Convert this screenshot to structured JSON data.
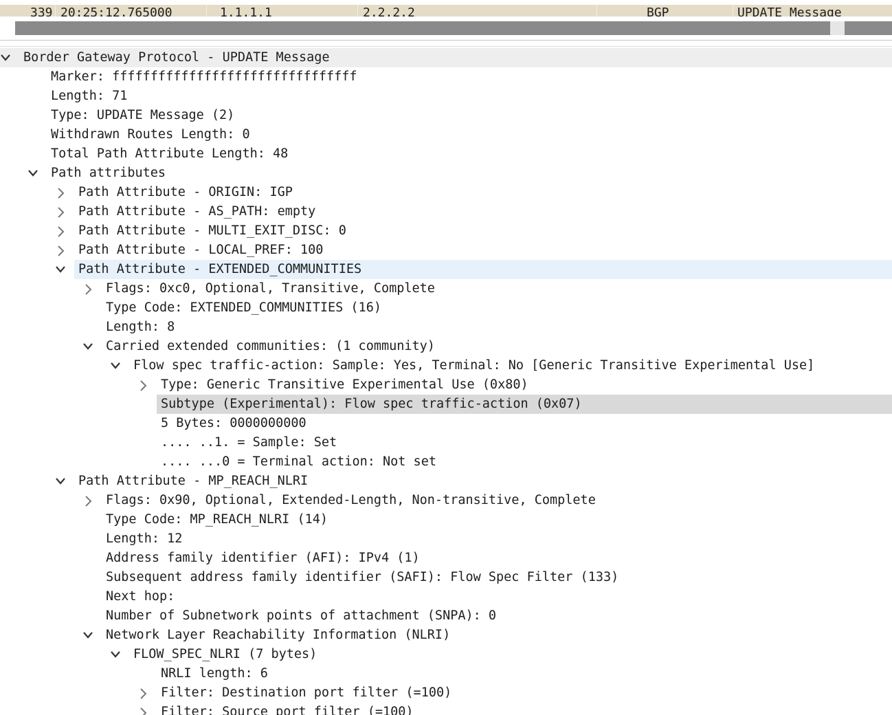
{
  "packet_list": {
    "row": {
      "no": "339",
      "time": "20:25:12.765000",
      "source": "1.1.1.1",
      "destination": "2.2.2.2",
      "protocol": "BGP",
      "info": "UPDATE Message"
    }
  },
  "tree": {
    "root": "Border Gateway Protocol - UPDATE Message",
    "marker": "Marker: ffffffffffffffffffffffffffffffff",
    "length": "Length: 71",
    "type": "Type: UPDATE Message (2)",
    "withdrawn": "Withdrawn Routes Length: 0",
    "total_path": "Total Path Attribute Length: 48",
    "path_attributes": "Path attributes",
    "pa_origin": "Path Attribute - ORIGIN: IGP",
    "pa_as_path": "Path Attribute - AS_PATH: empty",
    "pa_med": "Path Attribute - MULTI_EXIT_DISC: 0",
    "pa_local_pref": "Path Attribute - LOCAL_PREF: 100",
    "pa_ext_comm": "Path Attribute - EXTENDED_COMMUNITIES",
    "ec_flags": "Flags: 0xc0, Optional, Transitive, Complete",
    "ec_type_code": "Type Code: EXTENDED_COMMUNITIES (16)",
    "ec_length": "Length: 8",
    "ec_carried": "Carried extended communities: (1 community)",
    "ec_flowspec": "Flow spec traffic-action: Sample: Yes, Terminal: No [Generic Transitive Experimental Use]",
    "fs_type": "Type: Generic Transitive Experimental Use (0x80)",
    "fs_subtype": "Subtype (Experimental): Flow spec traffic-action (0x07)",
    "fs_bytes": "5 Bytes: 0000000000",
    "fs_sample": ".... ..1. = Sample: Set",
    "fs_terminal": ".... ...0 = Terminal action: Not set",
    "pa_mp_reach": "Path Attribute - MP_REACH_NLRI",
    "mp_flags": "Flags: 0x90, Optional, Extended-Length, Non-transitive, Complete",
    "mp_type_code": "Type Code: MP_REACH_NLRI (14)",
    "mp_length": "Length: 12",
    "mp_afi": "Address family identifier (AFI): IPv4 (1)",
    "mp_safi": "Subsequent address family identifier (SAFI): Flow Spec Filter (133)",
    "mp_next_hop": "Next hop:",
    "mp_snpa": "Number of Subnetwork points of attachment (SNPA): 0",
    "mp_nlri": "Network Layer Reachability Information (NLRI)",
    "nlri_flowspec": "FLOW_SPEC_NLRI (7 bytes)",
    "nlri_length": "NRLI length: 6",
    "nlri_filter_dst": "Filter: Destination port filter (=100)",
    "nlri_filter_src": "Filter: Source port filter (=100)"
  },
  "colors": {
    "packet_row_bg": "#e4dcc6",
    "selected_row_bg": "#e6f1fc",
    "highlighted_field_bg": "#d9d9d9",
    "root_row_bg": "#eeeeee"
  }
}
